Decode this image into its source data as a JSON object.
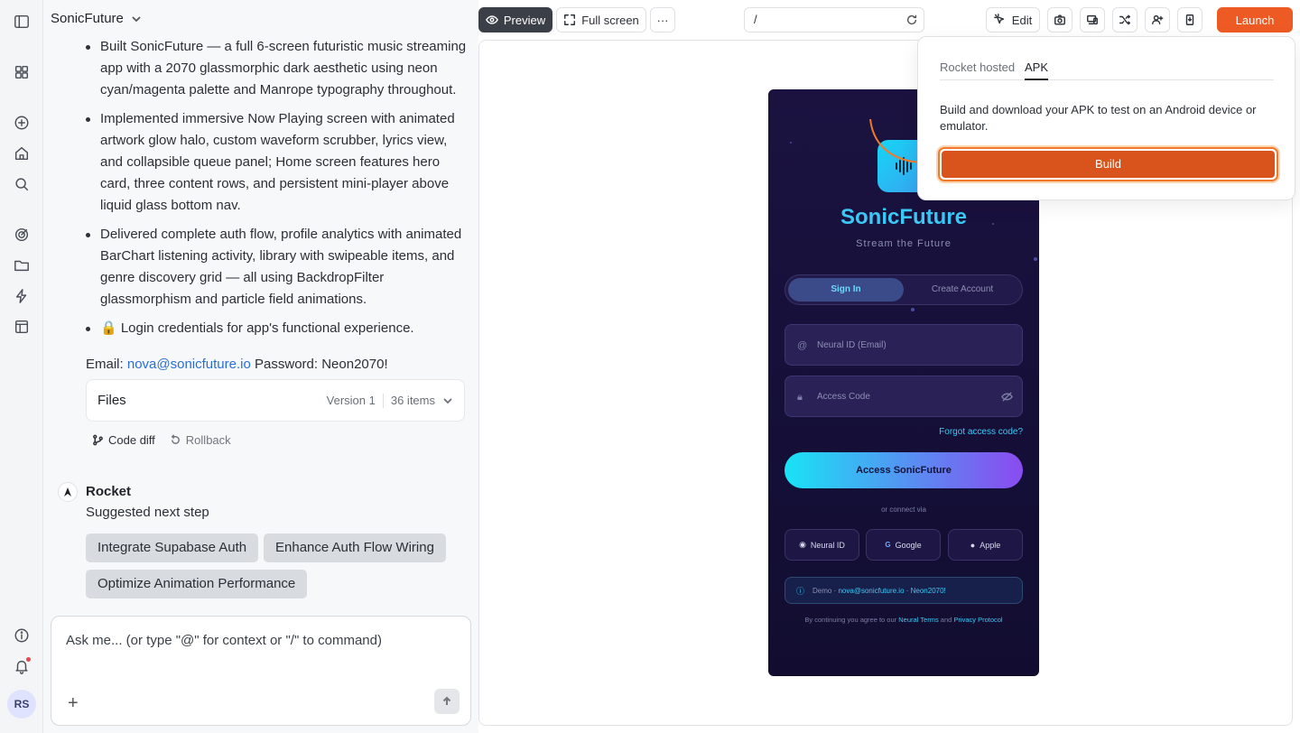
{
  "project": {
    "name": "SonicFuture"
  },
  "message": {
    "bullets": [
      "Built SonicFuture — a full 6-screen futuristic music streaming app with a 2070 glassmorphic dark aesthetic using neon cyan/magenta palette and Manrope typography throughout.",
      "Implemented immersive Now Playing screen with animated artwork glow halo, custom waveform scrubber, lyrics view, and collapsible queue panel; Home screen features hero card, three content rows, and persistent mini-player above liquid glass bottom nav.",
      "Delivered complete auth flow, profile analytics with animated BarChart listening activity, library with swipeable items, and genre discovery grid — all using BackdropFilter glassmorphism and particle field animations.",
      "🔒 Login credentials for app's functional experience."
    ],
    "email_label": "Email:",
    "email": "nova@sonicfuture.io",
    "password_label": "Password:",
    "password": "Neon2070!"
  },
  "files": {
    "label": "Files",
    "version": "Version 1",
    "count": "36 items"
  },
  "actions": {
    "code_diff": "Code diff",
    "rollback": "Rollback"
  },
  "assistant": {
    "name": "Rocket",
    "suggest_label": "Suggested next step",
    "chips": [
      "Integrate Supabase Auth",
      "Enhance Auth Flow Wiring",
      "Optimize Animation Performance"
    ]
  },
  "input": {
    "placeholder": "Ask me... (or type \"@\" for context or \"/\" to command)"
  },
  "toolbar": {
    "preview": "Preview",
    "fullscreen": "Full screen",
    "more": "···",
    "url": "/",
    "edit": "Edit",
    "launch": "Launch"
  },
  "user": {
    "initials": "RS"
  },
  "popover": {
    "tabs": [
      "Rocket hosted",
      "APK"
    ],
    "active_tab": "APK",
    "description": "Build and download your APK to test on an Android device or emulator.",
    "build_label": "Build"
  },
  "phone": {
    "brand": "SonicFuture",
    "tagline": "Stream the Future",
    "tab_signin": "Sign In",
    "tab_create": "Create Account",
    "email_placeholder": "Neural ID (Email)",
    "password_placeholder": "Access Code",
    "forgot": "Forgot access code?",
    "cta": "Access SonicFuture",
    "or": "or connect via",
    "social": [
      "Neural ID",
      "Google",
      "Apple"
    ],
    "demo_label": "Demo ·",
    "demo_value": "nova@sonicfuture.io · Neon2070!",
    "terms_prefix": "By continuing you agree to our",
    "terms_link1": "Neural Terms",
    "terms_and": "and",
    "terms_link2": "Privacy Protocol"
  },
  "colors": {
    "accent": "#ee5a24",
    "build": "#d9541c",
    "neon_cyan": "#3bc8f5",
    "phone_bg": "#1b1240"
  }
}
